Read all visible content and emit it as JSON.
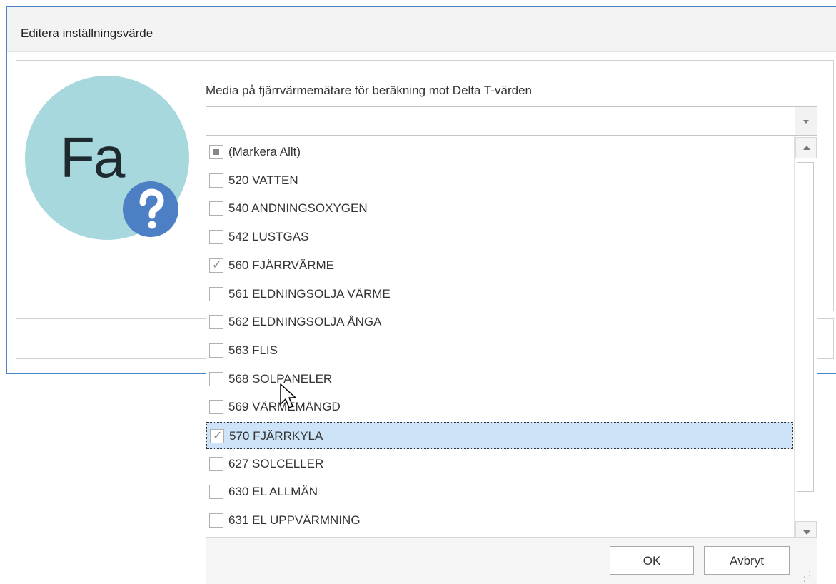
{
  "dialog": {
    "title": "Editera inställningsvärde"
  },
  "logo": {
    "text": "Fa",
    "badge_icon": "question-icon",
    "colors": {
      "circle": "#a7d8dd",
      "badge": "#4d7fc4"
    }
  },
  "field": {
    "label": "Media på fjärrvärmemätare för beräkning mot Delta T-värden",
    "value": ""
  },
  "dropdown": {
    "items": [
      {
        "label": "(Markera Allt)",
        "state": "indeterminate"
      },
      {
        "label": "520 VATTEN",
        "state": "unchecked"
      },
      {
        "label": "540 ANDNINGSOXYGEN",
        "state": "unchecked"
      },
      {
        "label": "542 LUSTGAS",
        "state": "unchecked"
      },
      {
        "label": "560 FJÄRRVÄRME",
        "state": "checked"
      },
      {
        "label": "561 ELDNINGSOLJA VÄRME",
        "state": "unchecked"
      },
      {
        "label": "562 ELDNINGSOLJA ÅNGA",
        "state": "unchecked"
      },
      {
        "label": "563 FLIS",
        "state": "unchecked"
      },
      {
        "label": "568 SOLPANELER",
        "state": "unchecked"
      },
      {
        "label": "569 VÄRMEMÄNGD",
        "state": "unchecked"
      },
      {
        "label": "570 FJÄRRKYLA",
        "state": "checked",
        "selected": true
      },
      {
        "label": "627 SOLCELLER",
        "state": "unchecked"
      },
      {
        "label": "630 EL ALLMÄN",
        "state": "unchecked"
      },
      {
        "label": "631 EL UPPVÄRMNING",
        "state": "unchecked"
      }
    ],
    "ok_label": "OK",
    "cancel_label": "Avbryt"
  },
  "colors": {
    "dialog_border": "#4a86c6",
    "selected_row": "#cde3f8"
  }
}
